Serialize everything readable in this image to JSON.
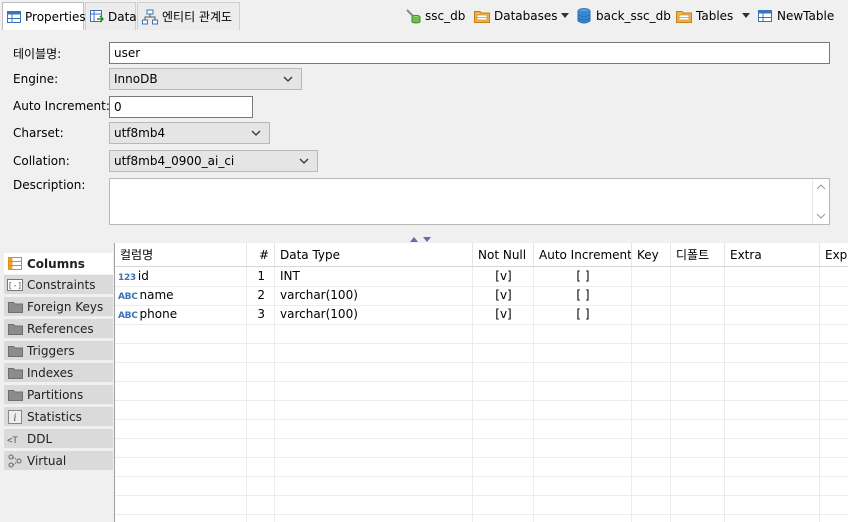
{
  "tabs": [
    {
      "label": "Properties",
      "icon": "table-properties-icon",
      "active": true
    },
    {
      "label": "Data",
      "icon": "data-grid-icon",
      "active": false
    },
    {
      "label": "엔티티 관계도",
      "icon": "er-diagram-icon",
      "active": false
    }
  ],
  "breadcrumbs": [
    {
      "label": "ssc_db",
      "icon": "database-connection-icon"
    },
    {
      "label": "Databases",
      "icon": "folder-icon"
    },
    {
      "label": "back_ssc_db",
      "icon": "database-icon"
    },
    {
      "label": "Tables",
      "icon": "folder-icon"
    },
    {
      "label": "NewTable",
      "icon": "table-icon"
    }
  ],
  "properties": {
    "table_name_label": "테이블명:",
    "table_name_value": "user",
    "engine_label": "Engine:",
    "engine_value": "InnoDB",
    "auto_increment_label": "Auto Increment:",
    "auto_increment_value": "0",
    "charset_label": "Charset:",
    "charset_value": "utf8mb4",
    "collation_label": "Collation:",
    "collation_value": "utf8mb4_0900_ai_ci",
    "description_label": "Description:",
    "description_value": ""
  },
  "side_tabs": [
    {
      "label": "Columns",
      "icon": "columns-icon",
      "active": true
    },
    {
      "label": "Constraints",
      "icon": "constraints-icon",
      "active": false
    },
    {
      "label": "Foreign Keys",
      "icon": "folder-icon",
      "active": false
    },
    {
      "label": "References",
      "icon": "folder-icon",
      "active": false
    },
    {
      "label": "Triggers",
      "icon": "folder-icon",
      "active": false
    },
    {
      "label": "Indexes",
      "icon": "folder-icon",
      "active": false
    },
    {
      "label": "Partitions",
      "icon": "folder-icon",
      "active": false
    },
    {
      "label": "Statistics",
      "icon": "info-icon",
      "active": false
    },
    {
      "label": "DDL",
      "icon": "ddl-icon",
      "active": false
    },
    {
      "label": "Virtual",
      "icon": "virtual-icon",
      "active": false
    }
  ],
  "columns_grid": {
    "headers": [
      "컬럼명",
      "#",
      "Data Type",
      "Not Null",
      "Auto Increment",
      "Key",
      "디폴트",
      "Extra",
      "Exp"
    ],
    "rows": [
      {
        "type_icon": "123",
        "name": "id",
        "num": "1",
        "data_type": "INT",
        "not_null": "[v]",
        "auto_increment": "[ ]",
        "key": "",
        "default": "",
        "extra": ""
      },
      {
        "type_icon": "ABC",
        "name": "name",
        "num": "2",
        "data_type": "varchar(100)",
        "not_null": "[v]",
        "auto_increment": "[ ]",
        "key": "",
        "default": "",
        "extra": ""
      },
      {
        "type_icon": "ABC",
        "name": "phone",
        "num": "3",
        "data_type": "varchar(100)",
        "not_null": "[v]",
        "auto_increment": "[ ]",
        "key": "",
        "default": "",
        "extra": ""
      }
    ]
  },
  "colors": {
    "accent_blue": "#3a73b6",
    "folder_orange": "#e8a33c",
    "selected_tab_bg": "#ffffff",
    "inactive_tab_bg": "#dadada"
  }
}
